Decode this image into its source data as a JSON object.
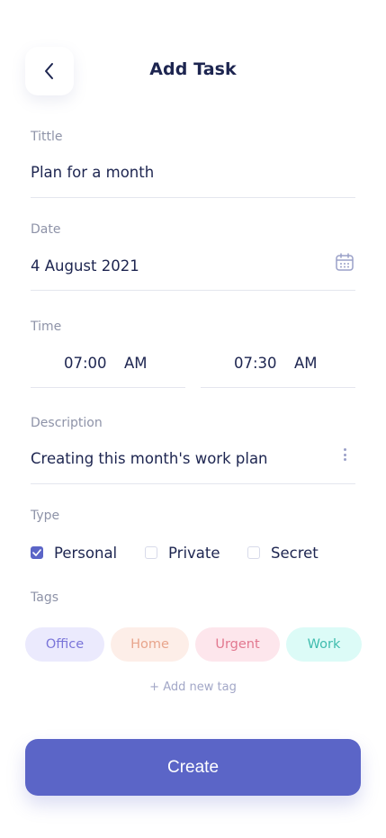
{
  "header": {
    "title": "Add Task",
    "back_icon": "chevron-left-icon"
  },
  "form": {
    "title": {
      "label": "Tittle",
      "value": "Plan for a month"
    },
    "date": {
      "label": "Date",
      "value": "4 August 2021",
      "icon": "calendar-icon"
    },
    "time": {
      "label": "Time",
      "start": {
        "time": "07:00",
        "period": "AM"
      },
      "end": {
        "time": "07:30",
        "period": "AM"
      }
    },
    "description": {
      "label": "Description",
      "value": "Creating this month's work plan",
      "icon": "more-vertical-icon"
    },
    "type": {
      "label": "Type",
      "options": [
        {
          "label": "Personal",
          "checked": true
        },
        {
          "label": "Private",
          "checked": false
        },
        {
          "label": "Secret",
          "checked": false
        }
      ]
    },
    "tags": {
      "label": "Tags",
      "items": [
        {
          "label": "Office",
          "bg": "#ebeafd",
          "color": "#7a75d9"
        },
        {
          "label": "Home",
          "bg": "#fdeee8",
          "color": "#e8a58c"
        },
        {
          "label": "Urgent",
          "bg": "#fde6ec",
          "color": "#e2788f"
        },
        {
          "label": "Work",
          "bg": "#dcfbf7",
          "color": "#3fbcae"
        }
      ],
      "add_label": "+ Add new tag"
    }
  },
  "actions": {
    "create_label": "Create"
  },
  "colors": {
    "accent": "#5b65c7",
    "text_primary": "#1d2550",
    "text_muted": "#8e93a8"
  }
}
